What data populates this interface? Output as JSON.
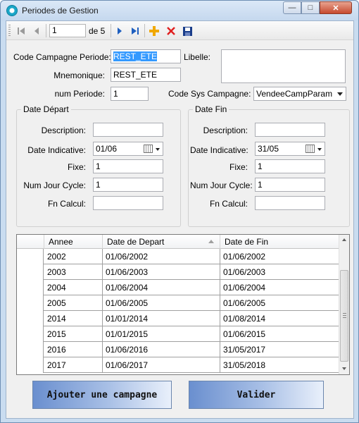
{
  "window": {
    "title": "Periodes de Gestion"
  },
  "toolbar": {
    "current_record": "1",
    "of_label": "de 5"
  },
  "form": {
    "code_campagne_periode_label": "Code Campagne Periode:",
    "code_campagne_periode_value": "REST_ETE",
    "libelle_label": "Libelle:",
    "libelle_value": "",
    "mnemonique_label": "Mnemonique:",
    "mnemonique_value": "REST_ETE",
    "num_periode_label": "num Periode:",
    "num_periode_value": "1",
    "code_sys_campagne_label": "Code Sys Campagne:",
    "code_sys_campagne_value": "VendeeCampParam"
  },
  "date_depart": {
    "title": "Date Départ",
    "description_label": "Description:",
    "description_value": "",
    "date_indicative_label": "Date Indicative:",
    "date_indicative_value": "01/06",
    "fixe_label": "Fixe:",
    "fixe_value": "1",
    "num_jour_cycle_label": "Num Jour Cycle:",
    "num_jour_cycle_value": "1",
    "fn_calcul_label": "Fn Calcul:",
    "fn_calcul_value": ""
  },
  "date_fin": {
    "title": "Date Fin",
    "description_label": "Description:",
    "description_value": "",
    "date_indicative_label": "Date Indicative:",
    "date_indicative_value": "31/05",
    "fixe_label": "Fixe:",
    "fixe_value": "1",
    "num_jour_cycle_label": "Num Jour Cycle:",
    "num_jour_cycle_value": "1",
    "fn_calcul_label": "Fn Calcul:",
    "fn_calcul_value": ""
  },
  "grid": {
    "columns": [
      "Annee",
      "Date de Depart",
      "Date de Fin"
    ],
    "rows": [
      [
        "2002",
        "01/06/2002",
        "01/06/2002"
      ],
      [
        "2003",
        "01/06/2003",
        "01/06/2003"
      ],
      [
        "2004",
        "01/06/2004",
        "01/06/2004"
      ],
      [
        "2005",
        "01/06/2005",
        "01/06/2005"
      ],
      [
        "2014",
        "01/01/2014",
        "01/08/2014"
      ],
      [
        "2015",
        "01/01/2015",
        "01/06/2015"
      ],
      [
        "2016",
        "01/06/2016",
        "31/05/2017"
      ],
      [
        "2017",
        "01/06/2017",
        "31/05/2018"
      ]
    ]
  },
  "buttons": {
    "add_campaign": "Ajouter une campagne",
    "validate": "Valider"
  },
  "icons": {
    "first": "first-record-icon",
    "prev": "previous-record-icon",
    "next": "next-record-icon",
    "last": "last-record-icon",
    "add": "add-icon",
    "delete": "delete-icon",
    "save": "save-icon"
  },
  "colors": {
    "add": "#f0a800",
    "delete": "#e02020",
    "save": "#1a3d8a",
    "selection": "#3399ff"
  }
}
